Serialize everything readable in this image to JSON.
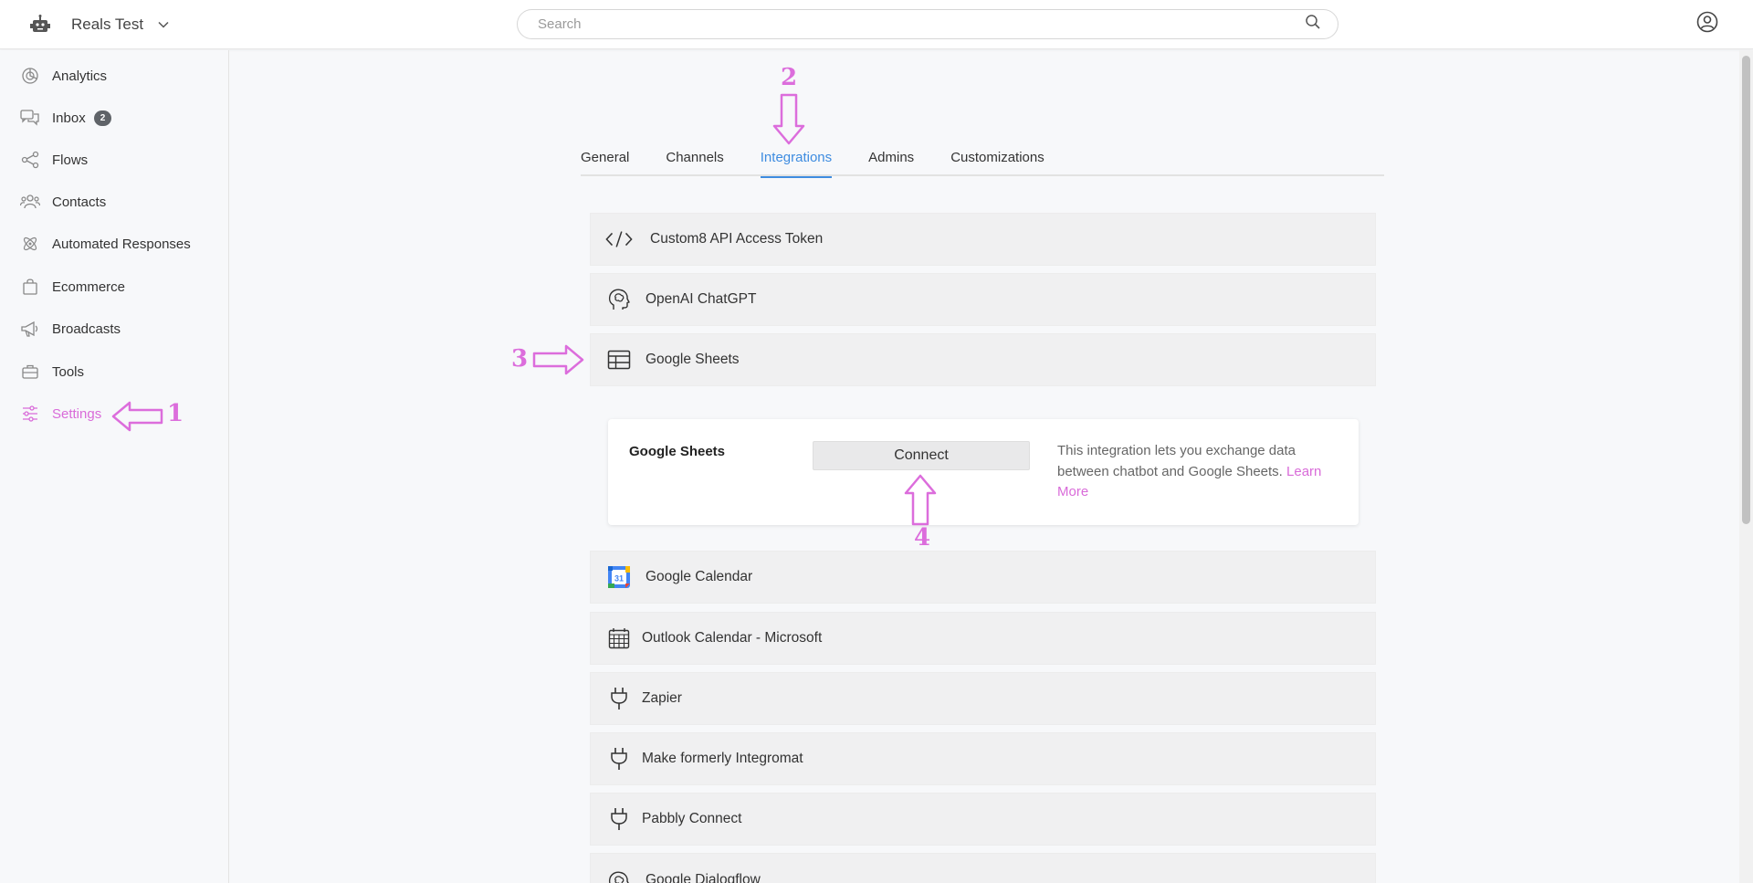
{
  "topbar": {
    "workspace_name": "Reals Test",
    "search_placeholder": "Search"
  },
  "sidebar": {
    "items": [
      {
        "label": "Analytics",
        "icon": "pie-chart-icon"
      },
      {
        "label": "Inbox",
        "icon": "chat-icon",
        "badge": "2"
      },
      {
        "label": "Flows",
        "icon": "flows-icon"
      },
      {
        "label": "Contacts",
        "icon": "contacts-icon"
      },
      {
        "label": "Automated Responses",
        "icon": "atom-icon"
      },
      {
        "label": "Ecommerce",
        "icon": "shopping-bag-icon"
      },
      {
        "label": "Broadcasts",
        "icon": "megaphone-icon"
      },
      {
        "label": "Tools",
        "icon": "toolbox-icon"
      },
      {
        "label": "Settings",
        "icon": "sliders-icon",
        "active": true
      }
    ]
  },
  "tabs": [
    {
      "label": "General"
    },
    {
      "label": "Channels"
    },
    {
      "label": "Integrations",
      "active": true
    },
    {
      "label": "Admins"
    },
    {
      "label": "Customizations"
    }
  ],
  "integrations": [
    {
      "label": "Custom8 API Access Token",
      "icon": "code-icon"
    },
    {
      "label": "OpenAI ChatGPT",
      "icon": "brain-head-icon"
    },
    {
      "label": "Google Sheets",
      "icon": "table-icon",
      "expanded": true
    },
    {
      "label": "Google Calendar",
      "icon": "google-calendar-icon"
    },
    {
      "label": "Outlook Calendar - Microsoft",
      "icon": "calendar-grid-icon"
    },
    {
      "label": "Zapier",
      "icon": "plug-icon"
    },
    {
      "label": "Make formerly Integromat",
      "icon": "plug-icon"
    },
    {
      "label": "Pabbly Connect",
      "icon": "plug-icon"
    },
    {
      "label": "Google Dialogflow",
      "icon": "brain-head-icon"
    }
  ],
  "connect_card": {
    "title": "Google Sheets",
    "button_label": "Connect",
    "description": "This integration lets you exchange data between chatbot and Google Sheets.",
    "link_text": "Learn More"
  },
  "annotations": {
    "step1": "1",
    "step2": "2",
    "step3": "3",
    "step4": "4",
    "color": "#dc6ddc"
  },
  "colors": {
    "accent_active_tab": "#3e8ce0",
    "settings_highlight": "#d96bd9"
  }
}
